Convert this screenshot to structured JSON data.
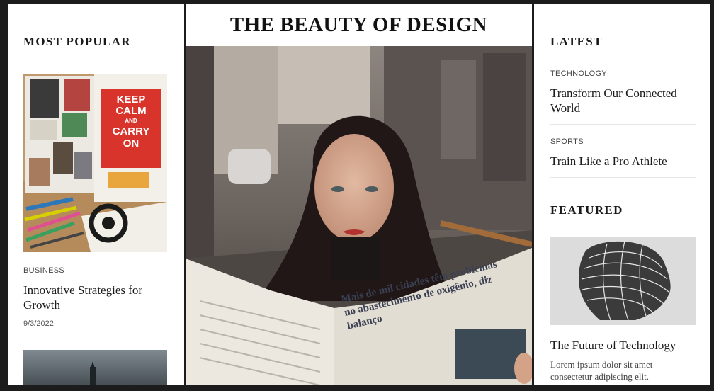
{
  "most_popular": {
    "section_title": "MOST POPULAR",
    "article": {
      "category": "BUSINESS",
      "title": "Innovative Strategies for Growth",
      "date": "9/3/2022",
      "poster_text": [
        "KEEP",
        "CALM",
        "AND",
        "CARRY",
        "ON"
      ]
    }
  },
  "hero": {
    "title": "THE BEAUTY OF DESIGN",
    "newspaper_text": "Mais de mil cidades têm problemas no abastecimento de oxigênio, diz balanço"
  },
  "latest": {
    "section_title": "LATEST",
    "items": [
      {
        "category": "TECHNOLOGY",
        "title": "Transform Our Connected World"
      },
      {
        "category": "SPORTS",
        "title": "Train Like a Pro Athlete"
      }
    ]
  },
  "featured": {
    "section_title": "FEATURED",
    "article": {
      "title": "The Future of Technology",
      "excerpt": "Lorem ipsum dolor sit amet consectetur adipiscing elit."
    }
  },
  "colors": {
    "background": "#1c1c1c",
    "panel": "#ffffff",
    "poster_red": "#d9342b"
  }
}
